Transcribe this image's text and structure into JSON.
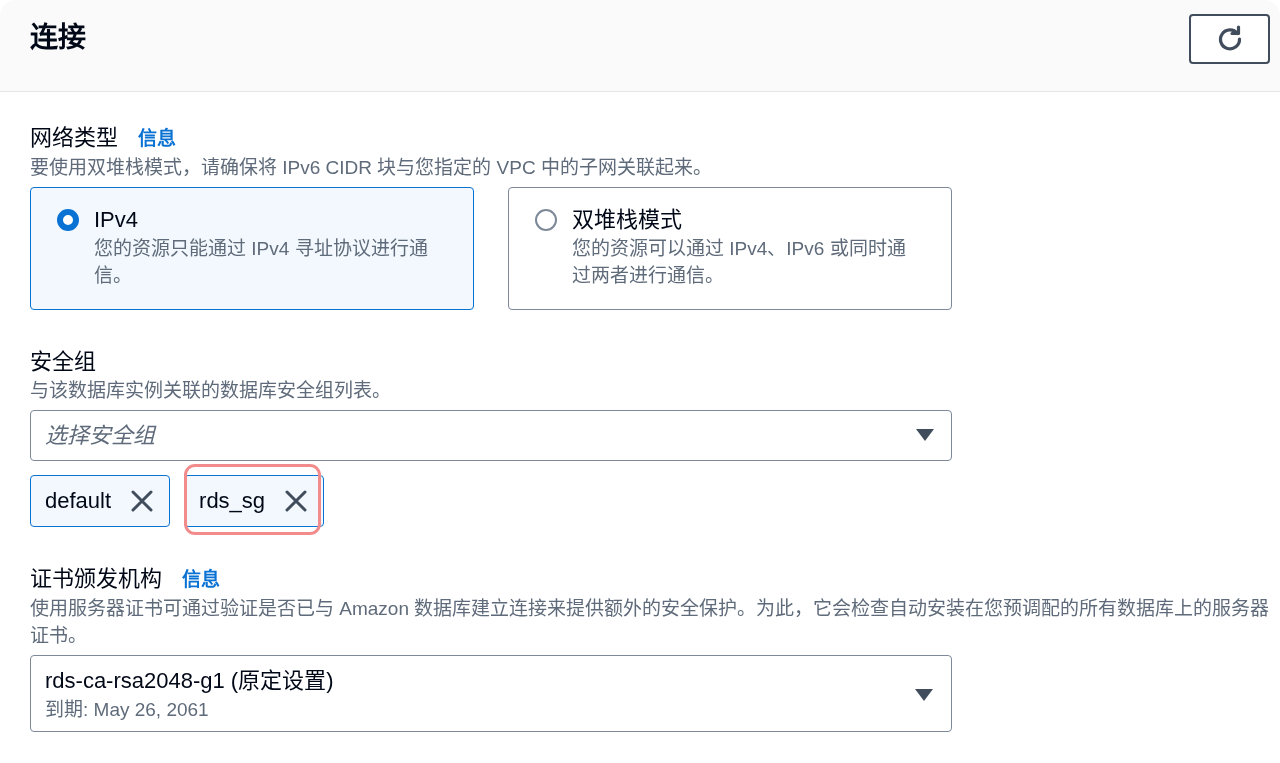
{
  "header": {
    "title": "连接"
  },
  "network_type": {
    "label": "网络类型",
    "info_link": "信息",
    "description": "要使用双堆栈模式，请确保将 IPv6 CIDR 块与您指定的 VPC 中的子网关联起来。",
    "options": [
      {
        "label": "IPv4",
        "description": "您的资源只能通过 IPv4 寻址协议进行通信。",
        "selected": true
      },
      {
        "label": "双堆栈模式",
        "description": "您的资源可以通过 IPv4、IPv6 或同时通过两者进行通信。",
        "selected": false
      }
    ]
  },
  "security_groups": {
    "label": "安全组",
    "description": "与该数据库实例关联的数据库安全组列表。",
    "placeholder": "选择安全组",
    "tokens": [
      {
        "label": "default",
        "highlighted": false
      },
      {
        "label": "rds_sg",
        "highlighted": true
      }
    ]
  },
  "certificate_authority": {
    "label": "证书颁发机构",
    "info_link": "信息",
    "description": "使用服务器证书可通过验证是否已与 Amazon 数据库建立连接来提供额外的安全保护。为此，它会检查自动安装在您预调配的所有数据库上的服务器证书。",
    "value": "rds-ca-rsa2048-g1 (原定设置)",
    "secondary": "到期: May 26, 2061"
  }
}
